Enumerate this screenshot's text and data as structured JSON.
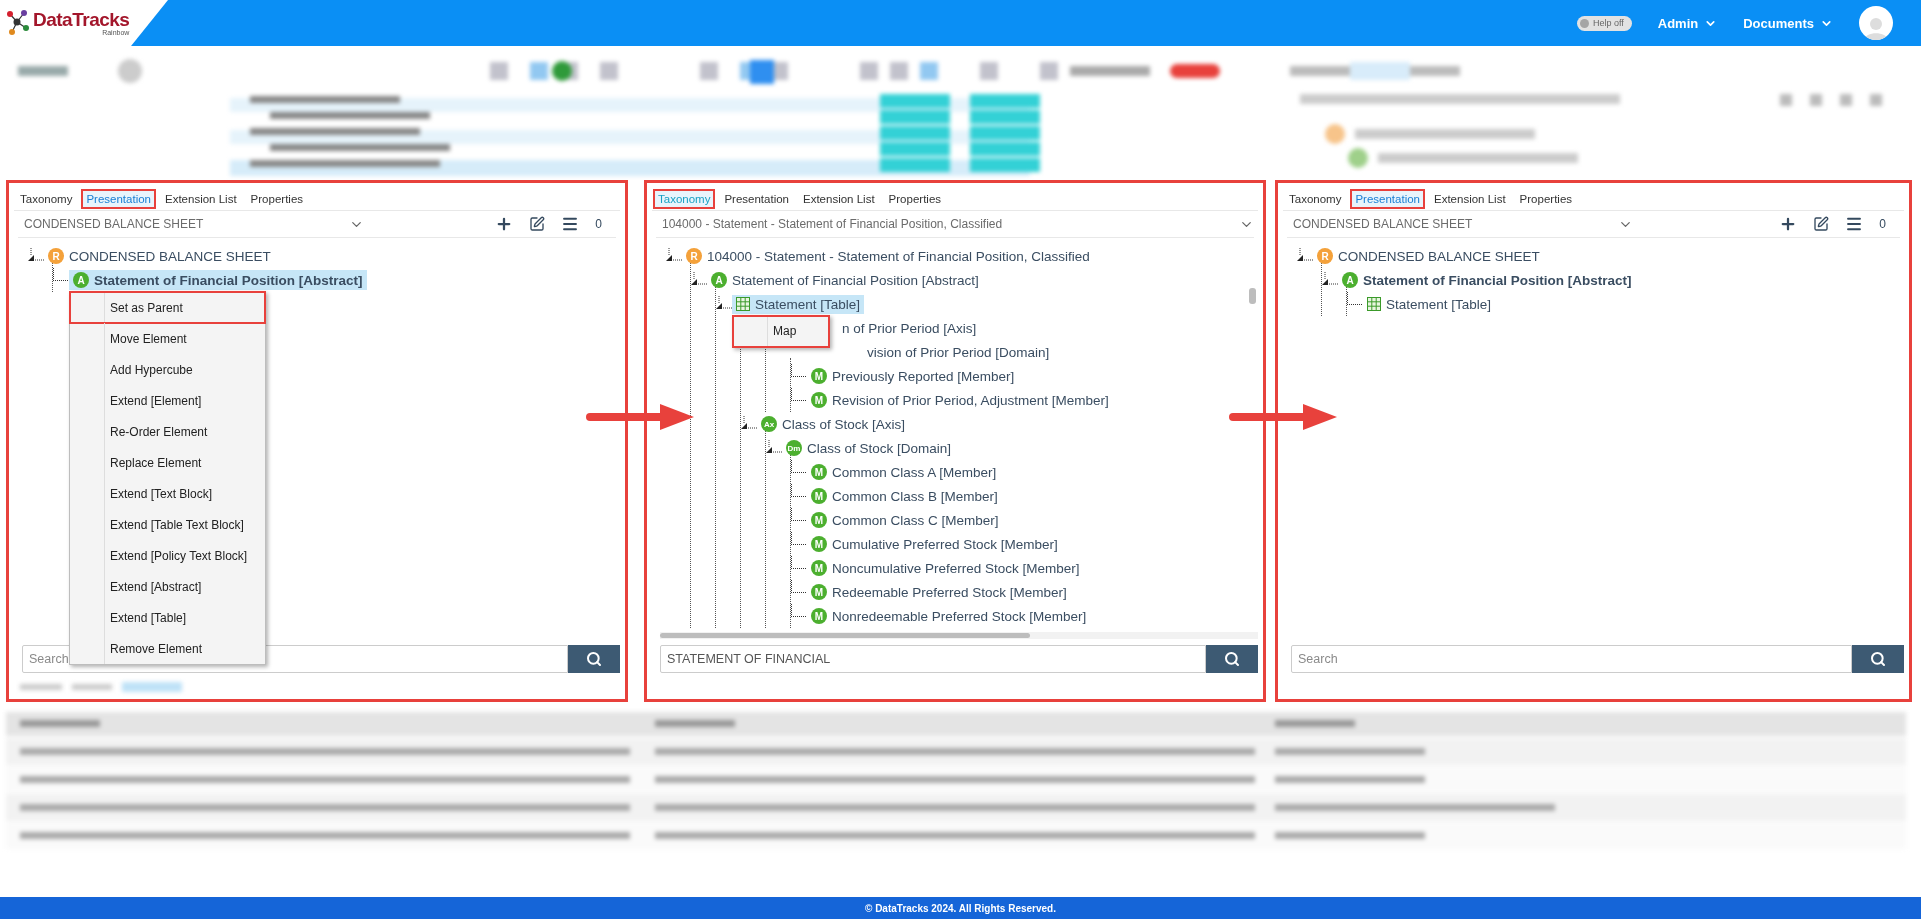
{
  "header": {
    "logo": {
      "name": "DataTracks",
      "tagline": "Rainbow"
    },
    "help_toggle": {
      "label": "Help off",
      "on": false
    },
    "menus": [
      {
        "label": "Admin"
      },
      {
        "label": "Documents"
      }
    ]
  },
  "panels": [
    {
      "tabs": [
        {
          "label": "Taxonomy",
          "selected": false,
          "callout": false
        },
        {
          "label": "Presentation",
          "selected": true,
          "callout": true
        },
        {
          "label": "Extension List",
          "selected": false,
          "callout": false
        },
        {
          "label": "Properties",
          "selected": false,
          "callout": false
        }
      ],
      "dropdown": "CONDENSED BALANCE SHEET",
      "toolbar": {
        "count": "0"
      },
      "scrollable": false,
      "tree": [
        {
          "kind": "root",
          "badge": "R",
          "label": "CONDENSED BALANCE SHEET",
          "selected": false,
          "bold": false,
          "children": [
            {
              "kind": "abstract",
              "badge": "A",
              "label": "Statement of Financial Position [Abstract]",
              "selected": true,
              "bold": true,
              "context_menu": [
                {
                  "label": "Set as Parent",
                  "callout": true
                },
                {
                  "label": "Move Element",
                  "callout": false
                },
                {
                  "label": "Add Hypercube",
                  "callout": false
                },
                {
                  "label": "Extend [Element]",
                  "callout": false
                },
                {
                  "label": "Re-Order Element",
                  "callout": false
                },
                {
                  "label": "Replace Element",
                  "callout": false
                },
                {
                  "label": "Extend [Text Block]",
                  "callout": false
                },
                {
                  "label": "Extend [Table Text Block]",
                  "callout": false
                },
                {
                  "label": "Extend [Policy Text Block]",
                  "callout": false
                },
                {
                  "label": "Extend [Abstract]",
                  "callout": false
                },
                {
                  "label": "Extend [Table]",
                  "callout": false
                },
                {
                  "label": "Remove Element",
                  "callout": false
                }
              ]
            }
          ]
        }
      ],
      "search": {
        "placeholder": "Search"
      }
    },
    {
      "tabs": [
        {
          "label": "Taxonomy",
          "selected": true,
          "callout": true
        },
        {
          "label": "Presentation",
          "selected": false,
          "callout": false
        },
        {
          "label": "Extension List",
          "selected": false,
          "callout": false
        },
        {
          "label": "Properties",
          "selected": false,
          "callout": false
        }
      ],
      "dropdown": "104000 - Statement - Statement of Financial Position, Classified",
      "scrollable": true,
      "tree": [
        {
          "kind": "root",
          "badge": "R",
          "label": "104000 - Statement - Statement of Financial Position, Classified",
          "selected": false,
          "bold": false,
          "children": [
            {
              "kind": "abstract",
              "badge": "A",
              "label": "Statement of Financial Position [Abstract]",
              "selected": false,
              "bold": false,
              "children": [
                {
                  "kind": "table",
                  "label": "Statement [Table]",
                  "selected": true,
                  "bold": false,
                  "context_menu": [
                    {
                      "label": "Map",
                      "callout": true
                    }
                  ],
                  "children": [
                    {
                      "kind": "axis",
                      "label": "n of Prior Period [Axis]",
                      "selected": false,
                      "bold": false,
                      "covered": true,
                      "children": [
                        {
                          "kind": "domain",
                          "label": "vision of Prior Period [Domain]",
                          "selected": false,
                          "bold": false,
                          "covered": true,
                          "children": [
                            {
                              "kind": "member",
                              "badge": "M",
                              "label": "Previously Reported [Member]",
                              "selected": false,
                              "bold": false
                            },
                            {
                              "kind": "member",
                              "badge": "M",
                              "label": "Revision of Prior Period, Adjustment [Member]",
                              "selected": false,
                              "bold": false
                            }
                          ]
                        }
                      ]
                    },
                    {
                      "kind": "axis",
                      "badge": "Ax",
                      "label": "Class of Stock [Axis]",
                      "selected": false,
                      "bold": false,
                      "children": [
                        {
                          "kind": "domain",
                          "badge": "Dm",
                          "label": "Class of Stock [Domain]",
                          "selected": false,
                          "bold": false,
                          "children": [
                            {
                              "kind": "member",
                              "badge": "M",
                              "label": "Common Class A [Member]",
                              "selected": false,
                              "bold": false
                            },
                            {
                              "kind": "member",
                              "badge": "M",
                              "label": "Common Class B [Member]",
                              "selected": false,
                              "bold": false
                            },
                            {
                              "kind": "member",
                              "badge": "M",
                              "label": "Common Class C [Member]",
                              "selected": false,
                              "bold": false
                            },
                            {
                              "kind": "member",
                              "badge": "M",
                              "label": "Cumulative Preferred Stock [Member]",
                              "selected": false,
                              "bold": false
                            },
                            {
                              "kind": "member",
                              "badge": "M",
                              "label": "Noncumulative Preferred Stock [Member]",
                              "selected": false,
                              "bold": false
                            },
                            {
                              "kind": "member",
                              "badge": "M",
                              "label": "Redeemable Preferred Stock [Member]",
                              "selected": false,
                              "bold": false
                            },
                            {
                              "kind": "member",
                              "badge": "M",
                              "label": "Nonredeemable Preferred Stock [Member]",
                              "selected": false,
                              "bold": false
                            }
                          ]
                        }
                      ]
                    }
                  ]
                }
              ]
            }
          ]
        }
      ],
      "search": {
        "value": "STATEMENT OF FINANCIAL"
      }
    },
    {
      "tabs": [
        {
          "label": "Taxonomy",
          "selected": false,
          "callout": false
        },
        {
          "label": "Presentation",
          "selected": true,
          "callout": true
        },
        {
          "label": "Extension List",
          "selected": false,
          "callout": false
        },
        {
          "label": "Properties",
          "selected": false,
          "callout": false
        }
      ],
      "dropdown": "CONDENSED BALANCE SHEET",
      "toolbar": {
        "count": "0"
      },
      "scrollable": false,
      "tree": [
        {
          "kind": "root",
          "badge": "R",
          "label": "CONDENSED BALANCE SHEET",
          "selected": false,
          "bold": false,
          "children": [
            {
              "kind": "abstract",
              "badge": "A",
              "label": "Statement of Financial Position [Abstract]",
              "selected": false,
              "bold": true,
              "children": [
                {
                  "kind": "table",
                  "label": "Statement [Table]",
                  "selected": false,
                  "bold": false
                }
              ]
            }
          ]
        }
      ],
      "search": {
        "placeholder": "Search"
      }
    }
  ],
  "footer": "© DataTracks 2024. All Rights Reserved."
}
